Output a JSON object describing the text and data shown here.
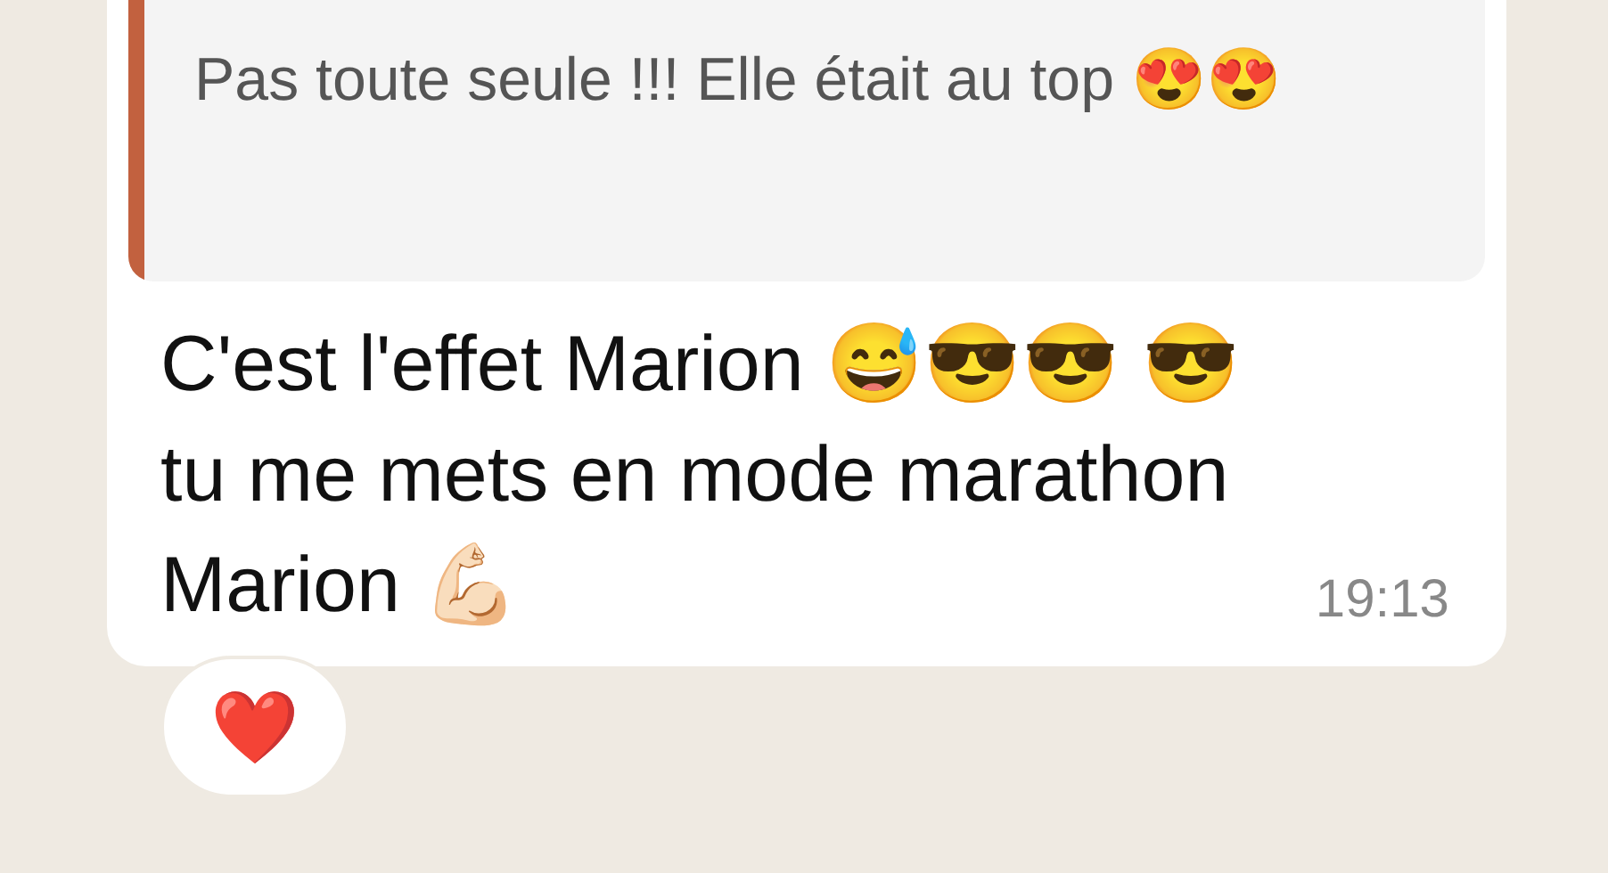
{
  "message": {
    "quote": {
      "text": "Pas toute seule !!! Elle était au top 😍😍",
      "color": "#c2613f"
    },
    "text": "C'est l'effet Marion 😅😎😎 😎 tu me mets en mode marathon Marion 💪🏻",
    "time": "19:13",
    "reaction": "❤️"
  }
}
